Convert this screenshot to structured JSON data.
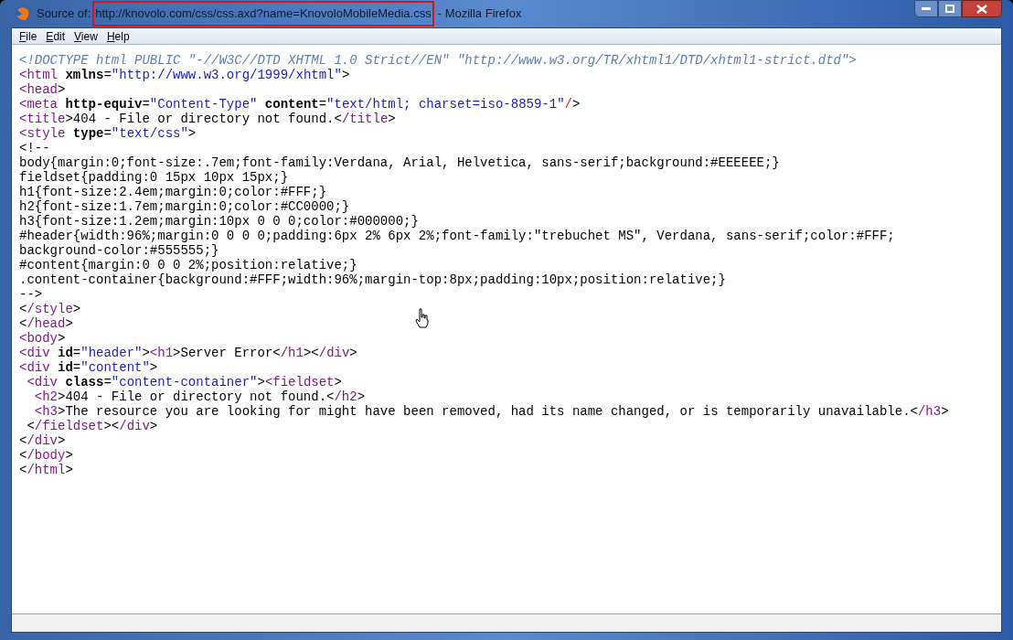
{
  "window": {
    "title_prefix": "Source of:",
    "title_url": "http://knovolo.com/css/css.axd?name=KnovoloMobileMedia.css",
    "url_highlighted": true,
    "title_suffix": "- Mozilla Firefox"
  },
  "menu": [
    {
      "label": "File"
    },
    {
      "label": "Edit"
    },
    {
      "label": "View"
    },
    {
      "label": "Help"
    }
  ],
  "source_lines": [
    [
      {
        "kind": "doctype",
        "text": "<!DOCTYPE html PUBLIC \"-//W3C//DTD XHTML 1.0 Strict//EN\" \"http://www.w3.org/TR/xhtml1/DTD/xhtml1-strict.dtd\">"
      }
    ],
    [
      {
        "kind": "tag",
        "text": "<html"
      },
      {
        "kind": "attr",
        "text": " xmlns"
      },
      {
        "kind": "text",
        "text": "="
      },
      {
        "kind": "value",
        "text": "\"http://www.w3.org/1999/xhtml\""
      },
      {
        "kind": "text",
        "text": ">"
      }
    ],
    [
      {
        "kind": "tag",
        "text": "<head"
      },
      {
        "kind": "text",
        "text": ">"
      }
    ],
    [
      {
        "kind": "tag",
        "text": "<meta"
      },
      {
        "kind": "attr",
        "text": " http-equiv"
      },
      {
        "kind": "text",
        "text": "="
      },
      {
        "kind": "value",
        "text": "\"Content-Type\""
      },
      {
        "kind": "attr",
        "text": " content"
      },
      {
        "kind": "text",
        "text": "="
      },
      {
        "kind": "value",
        "text": "\"text/html; charset=iso-8859-1\""
      },
      {
        "kind": "error",
        "text": "/"
      },
      {
        "kind": "text",
        "text": ">"
      }
    ],
    [
      {
        "kind": "tag",
        "text": "<title"
      },
      {
        "kind": "text",
        "text": ">404 - File or directory not found.<"
      },
      {
        "kind": "tag",
        "text": "/title"
      },
      {
        "kind": "text",
        "text": ">"
      }
    ],
    [
      {
        "kind": "tag",
        "text": "<style"
      },
      {
        "kind": "attr",
        "text": " type"
      },
      {
        "kind": "text",
        "text": "="
      },
      {
        "kind": "value",
        "text": "\"text/css\""
      },
      {
        "kind": "text",
        "text": ">"
      }
    ],
    [
      {
        "kind": "text",
        "text": "<!--"
      }
    ],
    [
      {
        "kind": "text",
        "text": "body{margin:0;font-size:.7em;font-family:Verdana, Arial, Helvetica, sans-serif;background:#EEEEEE;}"
      }
    ],
    [
      {
        "kind": "text",
        "text": "fieldset{padding:0 15px 10px 15px;}"
      }
    ],
    [
      {
        "kind": "text",
        "text": "h1{font-size:2.4em;margin:0;color:#FFF;}"
      }
    ],
    [
      {
        "kind": "text",
        "text": "h2{font-size:1.7em;margin:0;color:#CC0000;}"
      }
    ],
    [
      {
        "kind": "text",
        "text": "h3{font-size:1.2em;margin:10px 0 0 0;color:#000000;}"
      }
    ],
    [
      {
        "kind": "text",
        "text": "#header{width:96%;margin:0 0 0 0;padding:6px 2% 6px 2%;font-family:\"trebuchet MS\", Verdana, sans-serif;color:#FFF;"
      }
    ],
    [
      {
        "kind": "text",
        "text": "background-color:#555555;}"
      }
    ],
    [
      {
        "kind": "text",
        "text": "#content{margin:0 0 0 2%;position:relative;}"
      }
    ],
    [
      {
        "kind": "text",
        "text": ".content-container{background:#FFF;width:96%;margin-top:8px;padding:10px;position:relative;}"
      }
    ],
    [
      {
        "kind": "text",
        "text": "-->"
      }
    ],
    [
      {
        "kind": "text",
        "text": "<"
      },
      {
        "kind": "tag",
        "text": "/style"
      },
      {
        "kind": "text",
        "text": ">"
      }
    ],
    [
      {
        "kind": "text",
        "text": "<"
      },
      {
        "kind": "tag",
        "text": "/head"
      },
      {
        "kind": "text",
        "text": ">"
      }
    ],
    [
      {
        "kind": "tag",
        "text": "<body"
      },
      {
        "kind": "text",
        "text": ">"
      }
    ],
    [
      {
        "kind": "tag",
        "text": "<div"
      },
      {
        "kind": "attr",
        "text": " id"
      },
      {
        "kind": "text",
        "text": "="
      },
      {
        "kind": "value",
        "text": "\"header\""
      },
      {
        "kind": "text",
        "text": ">"
      },
      {
        "kind": "tag",
        "text": "<h1"
      },
      {
        "kind": "text",
        "text": ">Server Error<"
      },
      {
        "kind": "tag",
        "text": "/h1"
      },
      {
        "kind": "text",
        "text": "><"
      },
      {
        "kind": "tag",
        "text": "/div"
      },
      {
        "kind": "text",
        "text": ">"
      }
    ],
    [
      {
        "kind": "tag",
        "text": "<div"
      },
      {
        "kind": "attr",
        "text": " id"
      },
      {
        "kind": "text",
        "text": "="
      },
      {
        "kind": "value",
        "text": "\"content\""
      },
      {
        "kind": "text",
        "text": ">"
      }
    ],
    [
      {
        "kind": "tag",
        "text": " <div"
      },
      {
        "kind": "attr",
        "text": " class"
      },
      {
        "kind": "text",
        "text": "="
      },
      {
        "kind": "value",
        "text": "\"content-container\""
      },
      {
        "kind": "text",
        "text": ">"
      },
      {
        "kind": "tag",
        "text": "<fieldset"
      },
      {
        "kind": "text",
        "text": ">"
      }
    ],
    [
      {
        "kind": "tag",
        "text": "  <h2"
      },
      {
        "kind": "text",
        "text": ">404 - File or directory not found.<"
      },
      {
        "kind": "tag",
        "text": "/h2"
      },
      {
        "kind": "text",
        "text": ">"
      }
    ],
    [
      {
        "kind": "tag",
        "text": "  <h3"
      },
      {
        "kind": "text",
        "text": ">The resource you are looking for might have been removed, had its name changed, or is temporarily unavailable.<"
      },
      {
        "kind": "tag",
        "text": "/h3"
      },
      {
        "kind": "text",
        "text": ">"
      }
    ],
    [
      {
        "kind": "text",
        "text": " <"
      },
      {
        "kind": "tag",
        "text": "/fieldset"
      },
      {
        "kind": "text",
        "text": "><"
      },
      {
        "kind": "tag",
        "text": "/div"
      },
      {
        "kind": "text",
        "text": ">"
      }
    ],
    [
      {
        "kind": "text",
        "text": "<"
      },
      {
        "kind": "tag",
        "text": "/div"
      },
      {
        "kind": "text",
        "text": ">"
      }
    ],
    [
      {
        "kind": "text",
        "text": "<"
      },
      {
        "kind": "tag",
        "text": "/body"
      },
      {
        "kind": "text",
        "text": ">"
      }
    ],
    [
      {
        "kind": "text",
        "text": "<"
      },
      {
        "kind": "tag",
        "text": "/html"
      },
      {
        "kind": "text",
        "text": ">"
      }
    ]
  ]
}
